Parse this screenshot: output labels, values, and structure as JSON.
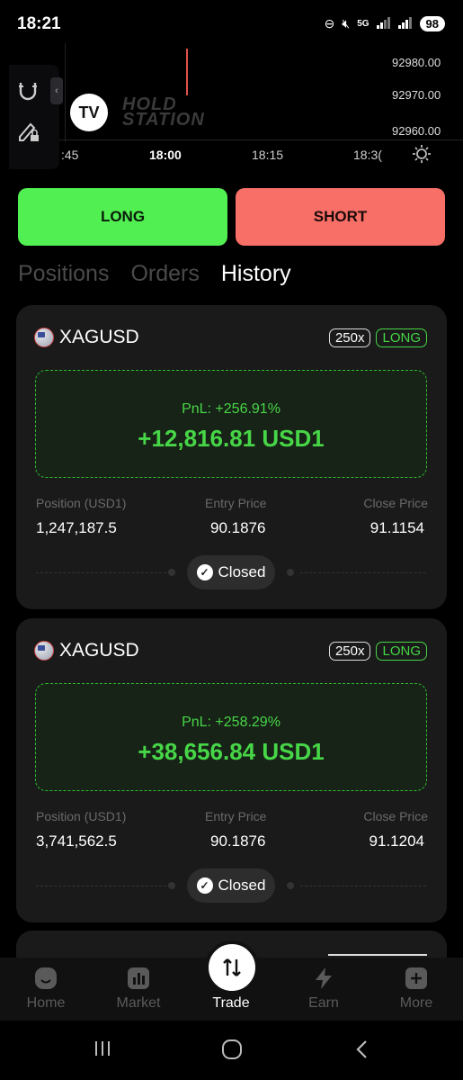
{
  "status": {
    "time": "18:21",
    "battery": "98",
    "network": "5G"
  },
  "chart": {
    "y_ticks": [
      "92980.00",
      "92970.00",
      "92960.00"
    ],
    "x_ticks": [
      ":45",
      "18:00",
      "18:15",
      "18:3("
    ],
    "watermark_line1": "HOLD",
    "watermark_line2": "STATION"
  },
  "trade": {
    "long_label": "LONG",
    "short_label": "SHORT"
  },
  "tabs": [
    {
      "label": "Positions"
    },
    {
      "label": "Orders"
    },
    {
      "label": "History"
    }
  ],
  "active_tab": "History",
  "positions": [
    {
      "symbol": "XAGUSD",
      "leverage": "250x",
      "side": "LONG",
      "pnl_percent": "PnL: +256.91%",
      "pnl_amount": "+12,816.81 USD1",
      "position_label": "Position (USD1)",
      "position_value": "1,247,187.5",
      "entry_label": "Entry Price",
      "entry_value": "90.1876",
      "close_label": "Close Price",
      "close_value": "91.1154",
      "status": "Closed"
    },
    {
      "symbol": "XAGUSD",
      "leverage": "250x",
      "side": "LONG",
      "pnl_percent": "PnL: +258.29%",
      "pnl_amount": "+38,656.84 USD1",
      "position_label": "Position (USD1)",
      "position_value": "3,741,562.5",
      "entry_label": "Entry Price",
      "entry_value": "90.1876",
      "close_label": "Close Price",
      "close_value": "91.1204",
      "status": "Closed"
    }
  ],
  "nav": [
    {
      "label": "Home",
      "icon": "home-icon"
    },
    {
      "label": "Market",
      "icon": "chart-icon"
    },
    {
      "label": "Trade",
      "icon": "swap-icon"
    },
    {
      "label": "Earn",
      "icon": "bolt-icon"
    },
    {
      "label": "More",
      "icon": "plus-icon"
    }
  ],
  "colors": {
    "long_green": "#52ef52",
    "short_red": "#f76f67",
    "pnl_green": "#47d647",
    "card_bg": "#1a1a1a"
  }
}
